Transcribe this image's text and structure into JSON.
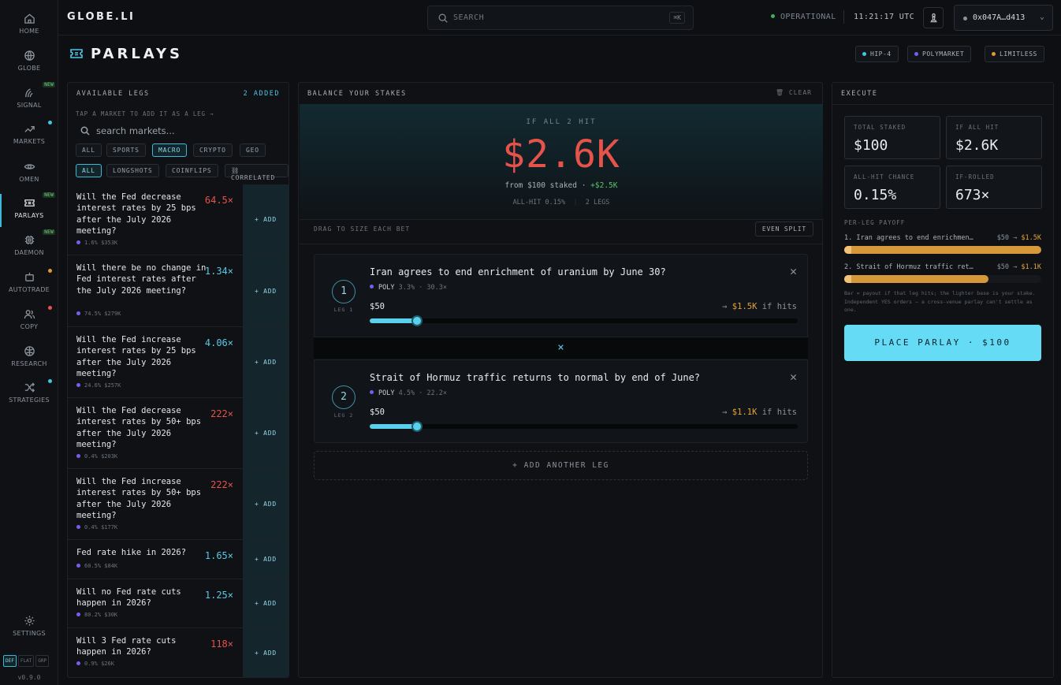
{
  "sidebar": {
    "items": [
      {
        "label": "HOME",
        "icon": "home-icon"
      },
      {
        "label": "GLOBE",
        "icon": "globe-icon"
      },
      {
        "label": "SIGNAL",
        "icon": "signal-icon",
        "badge": "NEW"
      },
      {
        "label": "MARKETS",
        "icon": "markets-icon"
      },
      {
        "label": "OMEN",
        "icon": "eye-icon"
      },
      {
        "label": "PARLAYS",
        "icon": "ticket-icon",
        "badge": "NEW"
      },
      {
        "label": "DAEMON",
        "icon": "chip-icon",
        "badge": "NEW"
      },
      {
        "label": "AUTOTRADE",
        "icon": "robot-icon"
      },
      {
        "label": "COPY",
        "icon": "users-icon"
      },
      {
        "label": "RESEARCH",
        "icon": "research-icon"
      },
      {
        "label": "STRATEGIES",
        "icon": "shuffle-icon"
      }
    ],
    "settings_label": "SETTINGS",
    "themes": [
      "DEF",
      "FLAT",
      "GRP"
    ],
    "version": "v0.9.0"
  },
  "topbar": {
    "logo": "GLOBE.LI",
    "search_placeholder": "SEARCH",
    "search_shortcut": "⌘K",
    "status": "OPERATIONAL",
    "clock": "11:21:17 UTC",
    "wallet": "0x047A…d413"
  },
  "page": {
    "title": "PARLAYS",
    "venues": [
      {
        "label": "HIP-4",
        "color": "#3fc7e6"
      },
      {
        "label": "POLYMARKET",
        "color": "#7b5cf0"
      },
      {
        "label": "LIMITLESS",
        "color": "#e39a36"
      }
    ]
  },
  "legs_panel": {
    "title": "AVAILABLE LEGS",
    "added": "2 ADDED",
    "hint": "TAP A MARKET TO ADD IT AS A LEG →",
    "search_placeholder": "search markets...",
    "categories": [
      "ALL",
      "SPORTS",
      "MACRO",
      "CRYPTO",
      "GEO"
    ],
    "filters": [
      "ALL",
      "LONGSHOTS",
      "COINFLIPS",
      "⛓ CORRELATED"
    ],
    "add_label": "+ ADD",
    "markets": [
      {
        "question": "Will the Fed decrease interest rates by 25 bps after the July 2026 meeting?",
        "mult": "64.5×",
        "meta": "1.6%  $353K"
      },
      {
        "question": "Will there be no change in Fed interest rates after the July 2026 meeting?",
        "mult": "1.34×",
        "meta": "74.5%  $279K"
      },
      {
        "question": "Will the Fed increase interest rates by 25 bps after the July 2026 meeting?",
        "mult": "4.06×",
        "meta": "24.6%  $257K"
      },
      {
        "question": "Will the Fed decrease interest rates by 50+ bps after the July 2026 meeting?",
        "mult": "222×",
        "meta": "0.4%  $203K"
      },
      {
        "question": "Will the Fed increase interest rates by 50+ bps after the July 2026 meeting?",
        "mult": "222×",
        "meta": "0.4%  $177K"
      },
      {
        "question": "Fed rate hike in 2026?",
        "mult": "1.65×",
        "meta": "60.5%  $84K"
      },
      {
        "question": "Will no Fed rate cuts happen in 2026?",
        "mult": "1.25×",
        "meta": "80.2%  $30K"
      },
      {
        "question": "Will 3 Fed rate cuts happen in 2026?",
        "mult": "118×",
        "meta": "0.9%  $26K"
      }
    ]
  },
  "stakes_panel": {
    "title": "BALANCE YOUR STAKES",
    "clear": "CLEAR",
    "if_all": "IF ALL 2 HIT",
    "payout": "$2.6K",
    "from_text": "from $100 staked ·",
    "profit": "+$2.5K",
    "all_hit": "ALL-HIT 0.15%",
    "legs_count": "2 LEGS",
    "drag_hint": "DRAG TO SIZE EACH BET",
    "even_split": "EVEN SPLIT",
    "legs": [
      {
        "num": "1",
        "label": "LEG 1",
        "title": "Iran agrees to end enrichment of uranium by June 30?",
        "venue": "POLY",
        "odds": "3.3% · 30.3×",
        "stake": "$50",
        "payout": "$1.5K",
        "if_hits": "if hits",
        "arrow": "→",
        "stake_fraction": 0.11
      },
      {
        "num": "2",
        "label": "LEG 2",
        "title": "Strait of Hormuz traffic returns to normal by end of June?",
        "venue": "POLY",
        "odds": "4.5% · 22.2×",
        "stake": "$50",
        "payout": "$1.1K",
        "if_hits": "if hits",
        "arrow": "→",
        "stake_fraction": 0.11
      }
    ],
    "join_symbol": "×",
    "add_another": "+ ADD ANOTHER LEG"
  },
  "execute_panel": {
    "title": "EXECUTE",
    "stats": [
      {
        "label": "TOTAL STAKED",
        "value": "$100"
      },
      {
        "label": "IF ALL HIT",
        "value": "$2.6K"
      },
      {
        "label": "ALL-HIT CHANCE",
        "value": "0.15%"
      },
      {
        "label": "IF-ROLLED",
        "value": "673×"
      }
    ],
    "per_leg_title": "PER-LEG PAYOFF",
    "per_leg": [
      {
        "label": "1. Iran agrees to end enrichmen…",
        "stake": "$50 →",
        "payout": "$1.5K",
        "fraction": 1.0
      },
      {
        "label": "2. Strait of Hormuz traffic ret…",
        "stake": "$50 →",
        "payout": "$1.1K",
        "fraction": 0.73
      }
    ],
    "fine_print": "Bar = payout if that leg hits; the lighter base is your stake. Independent YES orders — a cross-venue parlay can't settle as one.",
    "place_label": "PLACE PARLAY · $100"
  }
}
